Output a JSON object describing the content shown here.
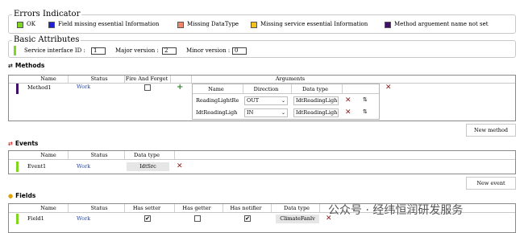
{
  "errors_indicator": {
    "title": "Errors Indicator",
    "items": [
      {
        "label": "OK",
        "color": "#7fd61f"
      },
      {
        "label": "Field missing essential Information",
        "color": "#1f1fd6"
      },
      {
        "label": "Missing DataType",
        "color": "#f0866a"
      },
      {
        "label": "Missing service essential Information",
        "color": "#f0c318"
      },
      {
        "label": "Method arguement name not set",
        "color": "#3f0f6a"
      }
    ]
  },
  "basic_attributes": {
    "title": "Basic Attributes",
    "status_color": "#7fd61f",
    "service_interface_id_label": "Service interface ID :",
    "service_interface_id": "1",
    "major_version_label": "Major version :",
    "major_version": "2",
    "minor_version_label": "Minor version :",
    "minor_version": "0"
  },
  "methods": {
    "title": "Methods",
    "icon": "swap-arrows-icon",
    "headers": {
      "name": "Name",
      "status": "Status",
      "fire_and_forget": "Fire And Forget",
      "arguments": "Arguments"
    },
    "row": {
      "name": "Method1",
      "status": "Work",
      "fire_and_forget": false,
      "status_color": "#3f0f6a"
    },
    "arguments_headers": {
      "name": "Name",
      "direction": "Direction",
      "data_type": "Data type"
    },
    "arguments": [
      {
        "name": "ReadingLightRe",
        "direction": "OUT",
        "data_type": "IdtReadingLigh"
      },
      {
        "name": "IdtReadingLigh",
        "direction": "IN",
        "data_type": "IdtReadingLigh"
      }
    ],
    "new_button": "New method"
  },
  "events": {
    "title": "Events",
    "icon": "exchange-arrows-icon",
    "headers": {
      "name": "Name",
      "status": "Status",
      "data_type": "Data type"
    },
    "row": {
      "name": "Event1",
      "status": "Work",
      "data_type": "IdtSrc",
      "status_color": "#7fd61f"
    },
    "new_button": "New event"
  },
  "fields": {
    "title": "Fields",
    "icon": "bulb-icon",
    "headers": {
      "name": "Name",
      "status": "Status",
      "has_setter": "Has setter",
      "has_getter": "Has getter",
      "has_notifier": "Has notifier",
      "data_type": "Data type"
    },
    "row": {
      "name": "Field1",
      "status": "Work",
      "has_setter": true,
      "has_getter": false,
      "has_notifier": true,
      "data_type": "ClimateFanlv",
      "status_color": "#7fd61f"
    }
  },
  "watermark": "公众号 · 经纬恒润研发服务"
}
